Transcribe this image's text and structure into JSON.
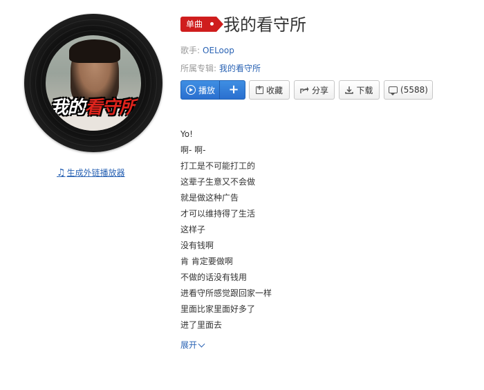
{
  "album_art": {
    "cover_text": "我的",
    "cover_text_red": "看守所"
  },
  "external_player_link": {
    "icon": "music-note-icon",
    "label": "生成外链播放器"
  },
  "song": {
    "badge": "单曲",
    "title": "我的看守所",
    "artist_label": "歌手:",
    "artist": "OELoop",
    "album_label": "所属专辑:",
    "album": "我的看守所"
  },
  "actions": {
    "play": "播放",
    "add": "+",
    "favorite": "收藏",
    "share": "分享",
    "download": "下载",
    "comments": "(5588)"
  },
  "lyrics": [
    "Yo!",
    "啊- 啊-",
    "打工是不可能打工的",
    "这辈子生意又不会做",
    "就是做这种广告",
    "才可以维持得了生活",
    "这样子",
    "没有钱啊",
    "肯 肯定要做啊",
    "不做的话没有钱用",
    "进看守所感觉跟回家一样",
    "里面比家里面好多了",
    "进了里面去"
  ],
  "expand_label": "展开",
  "colors": {
    "badge": "#cf1d1d",
    "link": "#2a63b4",
    "play_button": "#2a6fcf"
  }
}
